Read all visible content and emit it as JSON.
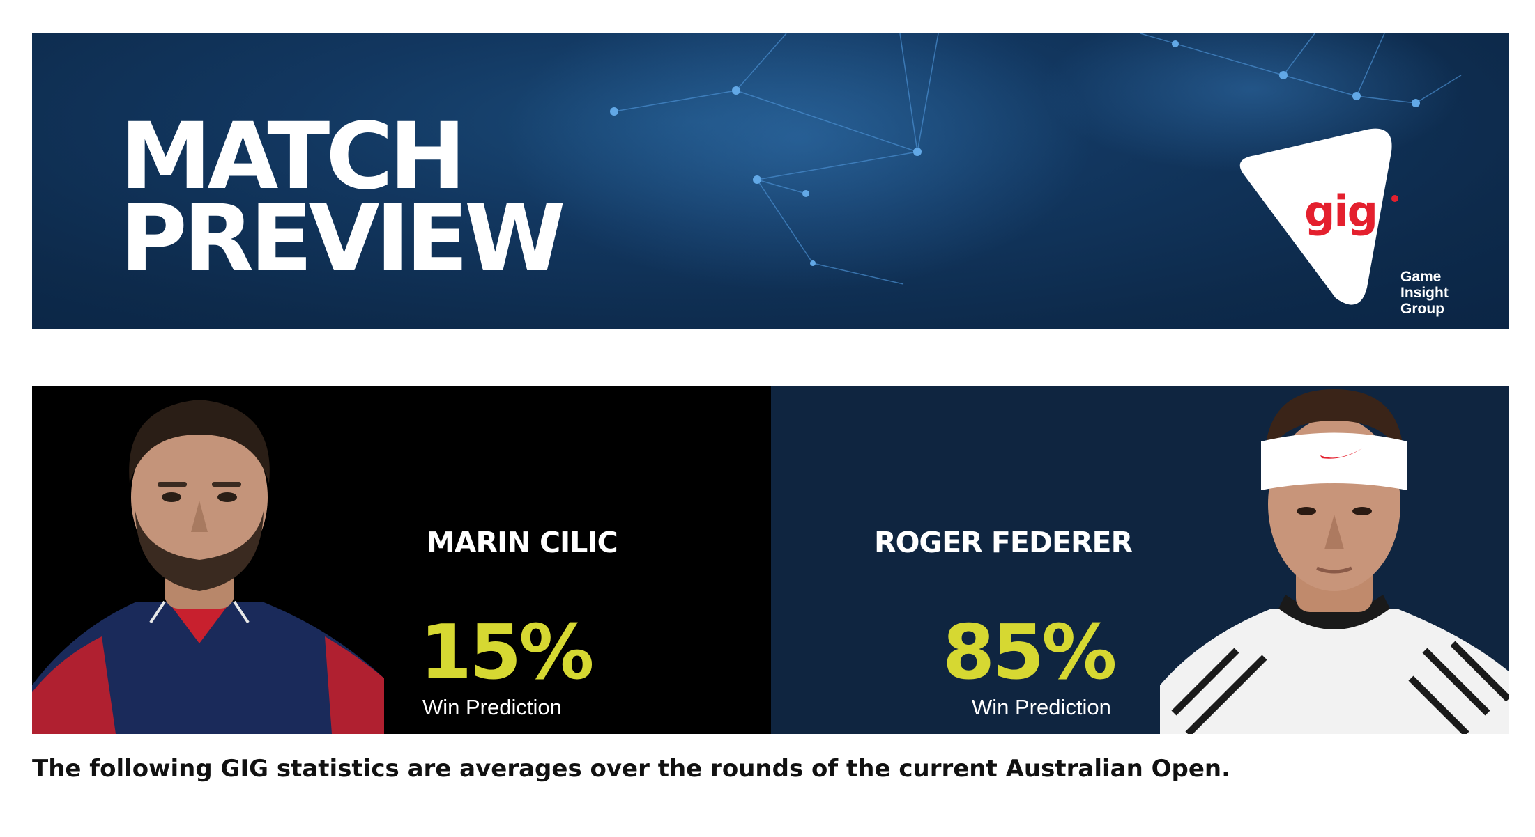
{
  "banner": {
    "title_line1": "MATCH",
    "title_line2": "PREVIEW",
    "logo": {
      "word": "gig",
      "sub_line1": "Game",
      "sub_line2": "Insight",
      "sub_line3": "Group"
    }
  },
  "players": [
    {
      "name": "MARIN CILIC",
      "win_pct": "15%",
      "win_label": "Win Prediction"
    },
    {
      "name": "ROGER FEDERER",
      "win_pct": "85%",
      "win_label": "Win Prediction"
    }
  ],
  "footnote": "The following GIG statistics are averages over the rounds of the current Australian Open.",
  "colors": {
    "banner_bg": "#0f2d4f",
    "left_panel_bg": "#000000",
    "right_panel_bg": "#0f2540",
    "accent_yellow": "#d6d832",
    "brand_red": "#e4202e"
  }
}
